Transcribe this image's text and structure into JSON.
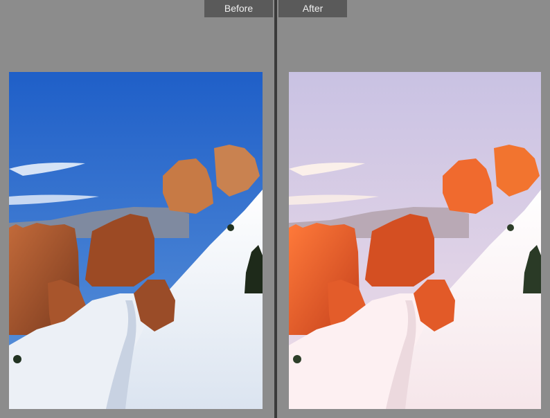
{
  "compare": {
    "before_label": "Before",
    "after_label": "After"
  },
  "colors": {
    "background": "#8c8c8c",
    "tab": "#5a5a5a",
    "divider": "#3a3a3a"
  }
}
